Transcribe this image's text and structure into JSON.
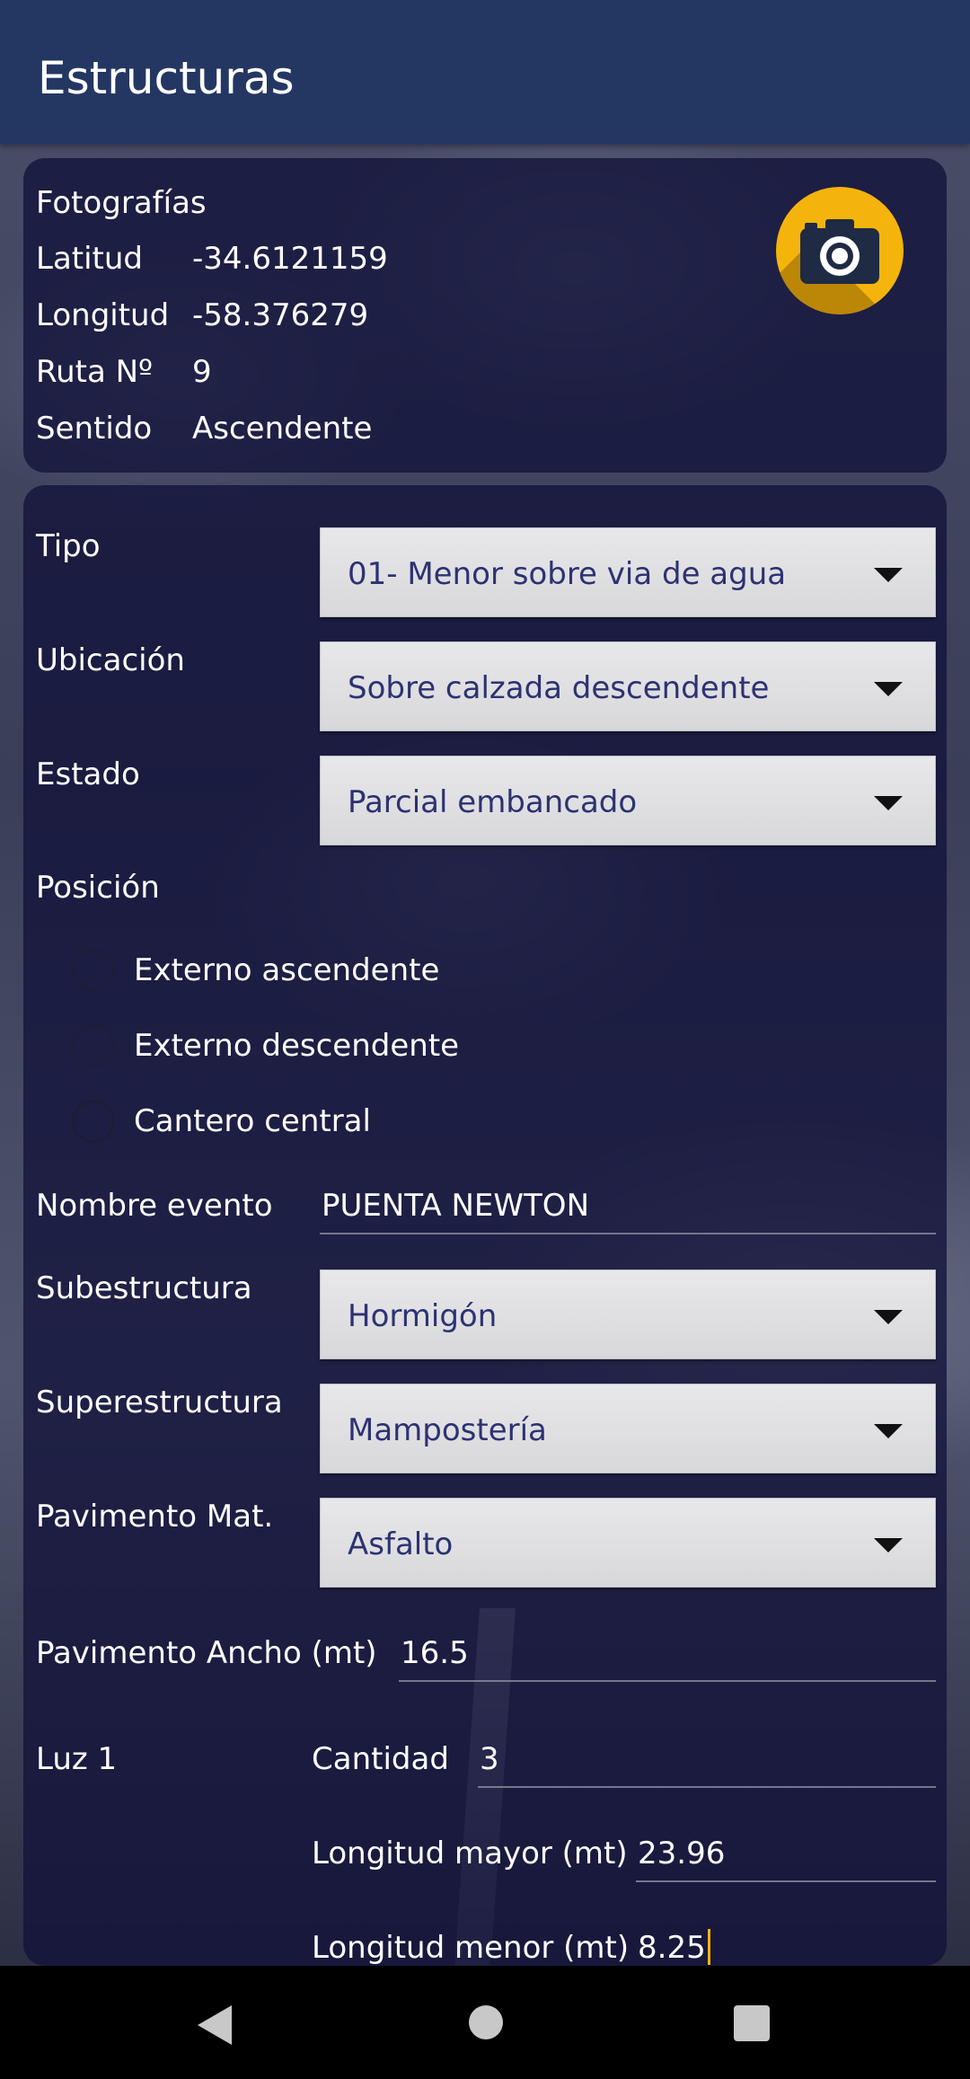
{
  "app": {
    "title": "Estructuras"
  },
  "info": {
    "photos_label": "Fotografías",
    "lat_label": "Latitud",
    "lat_value": "-34.6121159",
    "lon_label": "Longitud",
    "lon_value": "-58.376279",
    "route_label": "Ruta Nº",
    "route_value": "9",
    "direction_label": "Sentido",
    "direction_value": "Ascendente"
  },
  "form": {
    "tipo_label": "Tipo",
    "tipo_value": "01- Menor sobre via de agua",
    "ubicacion_label": "Ubicación",
    "ubicacion_value": "Sobre calzada descendente",
    "estado_label": "Estado",
    "estado_value": "Parcial embancado",
    "posicion_label": "Posición",
    "posicion_options": [
      "Externo ascendente",
      "Externo descendente",
      "Cantero central"
    ],
    "nombre_label": "Nombre evento",
    "nombre_value": "PUENTA NEWTON",
    "subestructura_label": "Subestructura",
    "subestructura_value": "Hormigón",
    "superestructura_label": "Superestructura",
    "superestructura_value": "Mampostería",
    "pavimento_mat_label": "Pavimento Mat.",
    "pavimento_mat_value": "Asfalto",
    "pavimento_ancho_label": "Pavimento Ancho (mt)",
    "pavimento_ancho_value": "16.5",
    "luz_label": "Luz 1",
    "cantidad_label": "Cantidad",
    "cantidad_value": "3",
    "long_mayor_label": "Longitud mayor (mt)",
    "long_mayor_value": "23.96",
    "long_menor_label": "Longitud menor (mt)",
    "long_menor_value": "8.25"
  },
  "colors": {
    "appbar": "#243763",
    "accent": "#f5b40c",
    "dropdown_text": "#2c3272"
  },
  "icons": {
    "camera": "camera-icon",
    "back": "back-icon",
    "home": "home-icon",
    "recents": "recents-icon"
  }
}
